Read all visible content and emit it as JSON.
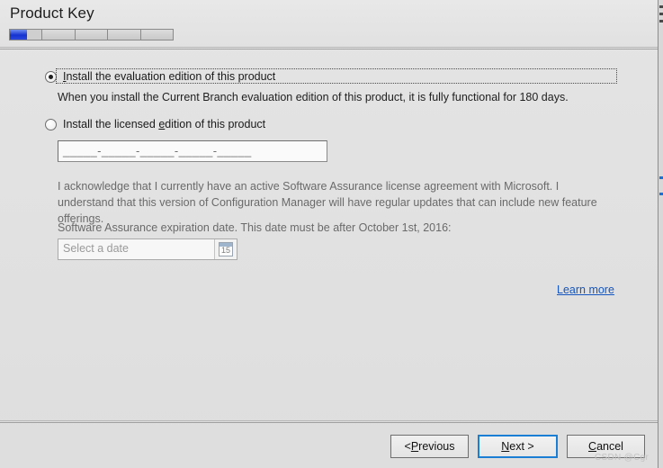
{
  "window": {
    "title": "Product Key"
  },
  "progress": {
    "total_steps": 5,
    "current_step": 1,
    "current_step_fill_percent": 55
  },
  "options": {
    "evaluation": {
      "label_before": "I",
      "label_mnemonic": "I",
      "label": "Install the evaluation edition of this product",
      "label_pre": "",
      "label_post": "nstall the evaluation edition of this product",
      "selected": true,
      "description": "When you install the Current Branch evaluation edition of this product, it is fully functional for 180 days."
    },
    "licensed": {
      "label_pre": "Install the licensed ",
      "label_mnemonic": "e",
      "label_post": "dition of this product",
      "selected": false
    }
  },
  "product_key": {
    "mask": "_____-_____-_____-_____-_____",
    "value": ""
  },
  "license_acknowledgment": "I acknowledge that I currently have an active Software Assurance license agreement with Microsoft. I understand that this version of Configuration Manager will have regular updates that can include new feature offerings.",
  "sa_expiration": {
    "label": "Software Assurance expiration date. This date must be after October 1st, 2016:",
    "placeholder": "Select a date",
    "value": "",
    "calendar_icon_day": "15"
  },
  "links": {
    "learn_more": "Learn more"
  },
  "footer": {
    "previous": {
      "pre": "< ",
      "mnemonic": "P",
      "post": "revious"
    },
    "next": {
      "pre": "",
      "mnemonic": "N",
      "post": "ext >"
    },
    "cancel": {
      "pre": "",
      "mnemonic": "C",
      "post": "ancel"
    }
  },
  "watermark": "CSDN @Cgr",
  "colors": {
    "window_background": "#e0e0e0",
    "progress_fill": "#1533cf",
    "link": "#1556c0",
    "default_button_border": "#1a7fd4",
    "muted_text": "#6a6a6a"
  }
}
